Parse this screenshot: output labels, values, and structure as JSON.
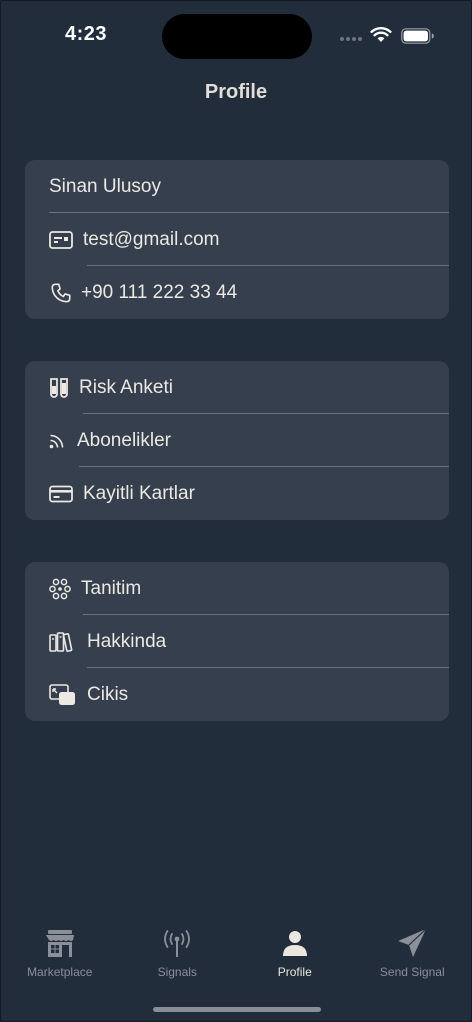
{
  "status_bar": {
    "time": "4:23"
  },
  "header": {
    "title": "Profile"
  },
  "profile_card": {
    "name": "Sinan Ulusoy",
    "email": "test@gmail.com",
    "phone": "+90 111 222 33 44"
  },
  "account_menu": {
    "items": [
      {
        "label": "Risk Anketi",
        "icon": "test-tubes-icon"
      },
      {
        "label": "Abonelikler",
        "icon": "rss-icon"
      },
      {
        "label": "Kayitli Kartlar",
        "icon": "credit-card-icon"
      }
    ]
  },
  "info_menu": {
    "items": [
      {
        "label": "Tanitim",
        "icon": "molecule-icon"
      },
      {
        "label": "Hakkinda",
        "icon": "books-icon"
      },
      {
        "label": "Cikis",
        "icon": "exit-icon"
      }
    ]
  },
  "tab_bar": {
    "tabs": [
      {
        "label": "Marketplace",
        "icon": "store-icon",
        "active": false
      },
      {
        "label": "Signals",
        "icon": "antenna-icon",
        "active": false
      },
      {
        "label": "Profile",
        "icon": "person-icon",
        "active": true
      },
      {
        "label": "Send Signal",
        "icon": "paper-plane-icon",
        "active": false
      }
    ]
  },
  "colors": {
    "background": "#222d3b",
    "card": "#363f4e",
    "text": "#ece8e2",
    "tab_inactive": "#8a8f98",
    "tab_active": "#ebe7e0"
  }
}
